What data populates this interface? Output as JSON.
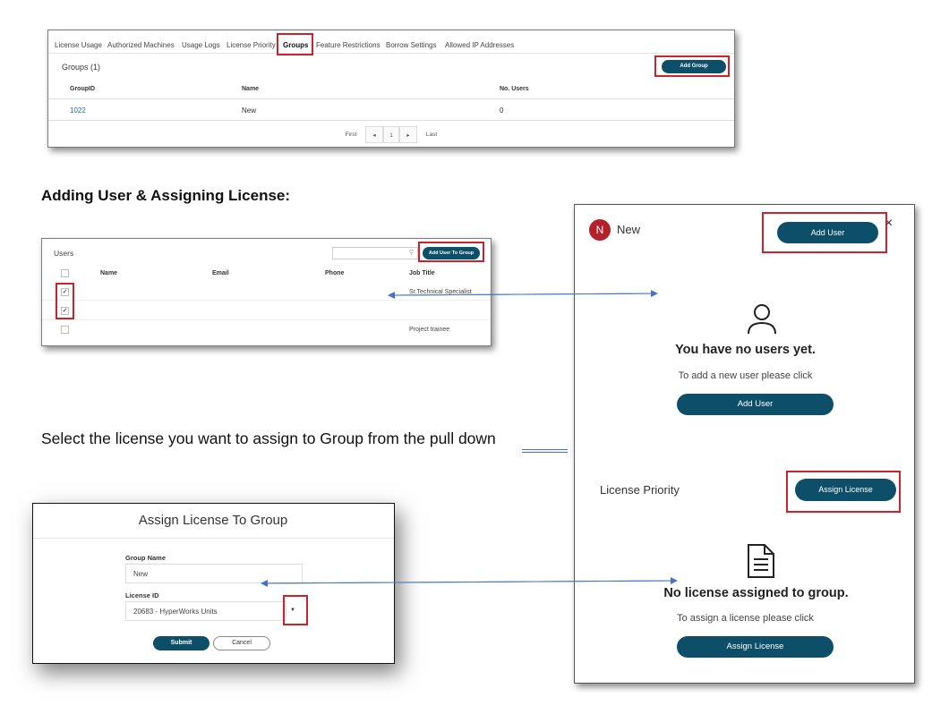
{
  "groups_panel": {
    "tabs": [
      "License Usage",
      "Authorized Machines",
      "Usage Logs",
      "License Priority",
      "Groups",
      "Feature Restrictions",
      "Borrow Settings",
      "Allowed IP Addresses"
    ],
    "active_tab": "Groups",
    "title": "Groups (1)",
    "add_button": "Add Group",
    "columns": [
      "GroupID",
      "Name",
      "No. Users"
    ],
    "rows": [
      {
        "id": "1022",
        "name": "New",
        "users": "0"
      }
    ],
    "pagination": {
      "first": "First",
      "page": "1",
      "last": "Last"
    }
  },
  "section_heading": "Adding User & Assigning License:",
  "users_panel": {
    "title": "Users",
    "search_placeholder": "",
    "add_button": "Add User To Group",
    "columns": [
      "Name",
      "Email",
      "Phone",
      "Job Title"
    ],
    "rows": [
      {
        "checked": true,
        "job_title": "Sr.Technical Specialist"
      },
      {
        "checked": true,
        "job_title": ""
      },
      {
        "checked": false,
        "job_title": "Project trainee"
      }
    ]
  },
  "instruction": "Select the license you want to assign to Group from the pull down",
  "assign_dialog": {
    "title": "Assign License To Group",
    "group_name_label": "Group Name",
    "group_name_value": "New",
    "license_id_label": "License ID",
    "license_id_value": "20683 - HyperWorks Units",
    "submit": "Submit",
    "cancel": "Cancel"
  },
  "group_panel": {
    "avatar_letter": "N",
    "group_name": "New",
    "add_user_top": "Add User",
    "close_glyph": "×",
    "no_users_title": "You have no users yet.",
    "no_users_hint": "To add a new user please click",
    "add_user_button": "Add User",
    "license_priority": "License Priority",
    "assign_license_top": "Assign License",
    "no_license_title": "No license assigned to group.",
    "no_license_hint": "To assign a license please click",
    "assign_license_button": "Assign License"
  },
  "colors": {
    "accent": "#0d4f68",
    "highlight_box": "#d0202c",
    "arrow": "#4472c4",
    "link": "#1f6f8b",
    "avatar": "#b3212b"
  }
}
